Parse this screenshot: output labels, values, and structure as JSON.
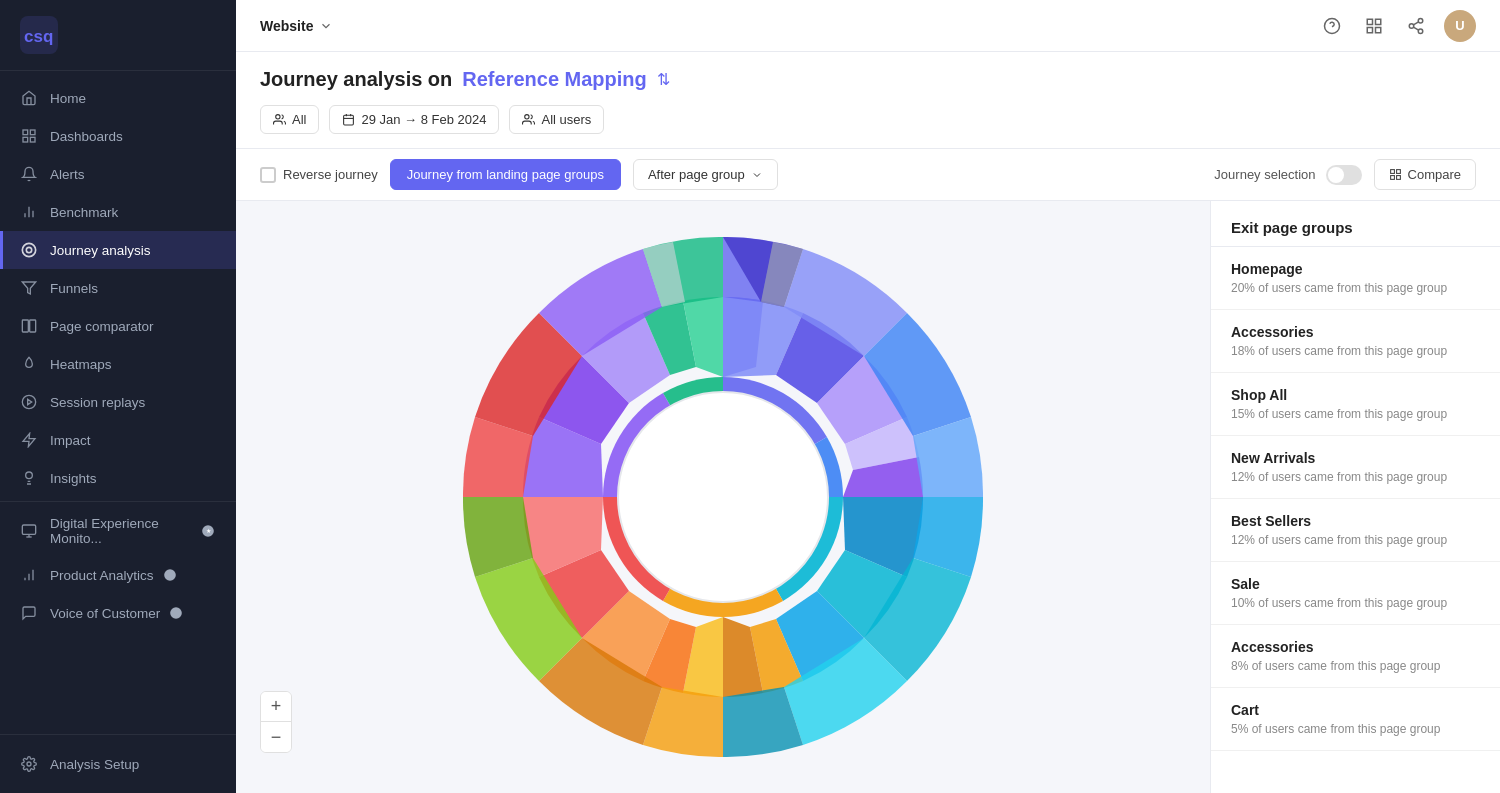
{
  "topnav": {
    "website": "Website",
    "help_label": "Help",
    "apps_label": "Apps",
    "share_label": "Share"
  },
  "sidebar": {
    "logo_text": "csq",
    "items": [
      {
        "id": "home",
        "label": "Home",
        "icon": "home",
        "active": false
      },
      {
        "id": "dashboards",
        "label": "Dashboards",
        "icon": "grid",
        "active": false
      },
      {
        "id": "alerts",
        "label": "Alerts",
        "icon": "bell",
        "active": false
      },
      {
        "id": "benchmark",
        "label": "Benchmark",
        "icon": "chart-bar",
        "active": false
      },
      {
        "id": "journey-analysis",
        "label": "Journey analysis",
        "icon": "map",
        "active": true
      },
      {
        "id": "funnels",
        "label": "Funnels",
        "icon": "funnel",
        "active": false
      },
      {
        "id": "page-comparator",
        "label": "Page comparator",
        "icon": "columns",
        "active": false
      },
      {
        "id": "heatmaps",
        "label": "Heatmaps",
        "icon": "fire",
        "active": false
      },
      {
        "id": "session-replays",
        "label": "Session replays",
        "icon": "play-circle",
        "active": false
      },
      {
        "id": "impact",
        "label": "Impact",
        "icon": "zap",
        "active": false
      },
      {
        "id": "insights",
        "label": "Insights",
        "icon": "lightbulb",
        "active": false
      }
    ],
    "section_groups": [
      {
        "id": "digital-experience",
        "label": "Digital Experience Monito...",
        "icon": "monitor",
        "has_badge": true
      },
      {
        "id": "product-analytics",
        "label": "Product Analytics",
        "icon": "bar-chart",
        "has_badge": true
      },
      {
        "id": "voice-of-customer",
        "label": "Voice of Customer",
        "icon": "message",
        "has_badge": true
      }
    ],
    "bottom_items": [
      {
        "id": "analysis-setup",
        "label": "Analysis Setup",
        "icon": "settings"
      }
    ]
  },
  "page_header": {
    "title_prefix": "Journey analysis on",
    "title_link": "Reference Mapping",
    "filters": {
      "segment": "All",
      "date_range": "29 Jan → 8 Feb 2024",
      "users": "All users"
    }
  },
  "journey_options": {
    "reverse_journey_label": "Reverse journey",
    "journey_from_label": "Journey from landing page groups",
    "after_page_group_label": "After page group",
    "journey_selection_label": "Journey selection",
    "compare_label": "Compare"
  },
  "exit_panel": {
    "title": "Exit page groups",
    "items": [
      {
        "name": "Homepage",
        "desc": "20% of users came from this page group"
      },
      {
        "name": "Accessories",
        "desc": "18% of users came from this page group"
      },
      {
        "name": "Shop All",
        "desc": "15% of users came from this page group"
      },
      {
        "name": "New Arrivals",
        "desc": "12% of users came from this page group"
      },
      {
        "name": "Best Sellers",
        "desc": "12% of users came from this page group"
      },
      {
        "name": "Sale",
        "desc": "10% of users came from this page group"
      },
      {
        "name": "Accessories",
        "desc": "8% of users came from this page group"
      },
      {
        "name": "Cart",
        "desc": "5% of users came from this page group"
      }
    ]
  },
  "zoom": {
    "plus_label": "+",
    "minus_label": "−"
  },
  "sunburst": {
    "colors": [
      "#6366f1",
      "#f59e0b",
      "#10b981",
      "#ef4444",
      "#3b82f6",
      "#8b5cf6",
      "#f97316",
      "#06b6d4",
      "#84cc16",
      "#ec4899",
      "#a78bfa",
      "#34d399",
      "#fbbf24",
      "#60a5fa",
      "#f87171",
      "#c084fc",
      "#4ade80",
      "#fb923c"
    ]
  }
}
